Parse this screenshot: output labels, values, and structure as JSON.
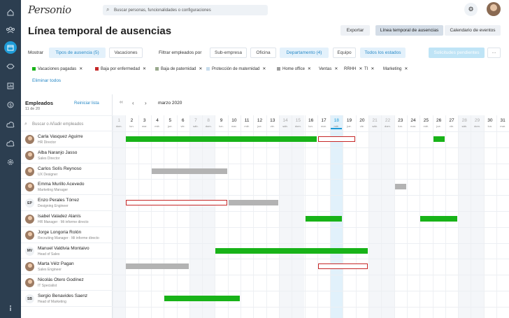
{
  "brand": {
    "logo": "Personio"
  },
  "search": {
    "placeholder": "Buscar personas, funcionalidades o configuraciones"
  },
  "page": {
    "title": "Línea temporal de ausencias"
  },
  "header_actions": {
    "export": "Exportar",
    "timeline": "Línea temporal de ausencias",
    "calendar": "Calendario de eventos"
  },
  "filters": {
    "show_label": "Mostrar",
    "absence_types": "Tipos de ausencia (5)",
    "vacations": "Vacaciones",
    "filter_label": "Filtrar empleados por",
    "subcompany": "Sub-empresa",
    "office": "Oficina",
    "department": "Departamento (4)",
    "team": "Equipo",
    "all_states": "Todos los estados",
    "pending": "Solicitudes pendientes",
    "more": "···",
    "clear": "Eliminar todos"
  },
  "tags": [
    {
      "label": "Vacaciones pagadas",
      "color": "#18b318"
    },
    {
      "label": "Baja por enfermedad",
      "color": "#c62828"
    },
    {
      "label": "Baja de paternidad",
      "color": "#9aaa8e"
    },
    {
      "label": "Protección de maternidad",
      "color": "#c7dcec"
    },
    {
      "label": "Home office",
      "color": "#9e9e9e"
    },
    {
      "label": "Ventas"
    },
    {
      "label": "RRHH"
    },
    {
      "label": "TI"
    },
    {
      "label": "Marketing"
    }
  ],
  "employees_panel": {
    "title": "Empleados",
    "count": "11 de 20",
    "reset": "Reiniciar lista",
    "search_placeholder": "Buscar o Añadir empleados"
  },
  "timeline": {
    "month": "marzo 2020",
    "prev": "‹",
    "next": "›",
    "first": "‹‹",
    "today_index": 17
  },
  "days": [
    {
      "n": "1",
      "d": "dom.",
      "we": true
    },
    {
      "n": "2",
      "d": "lun.",
      "we": false
    },
    {
      "n": "3",
      "d": "mar.",
      "we": false
    },
    {
      "n": "4",
      "d": "mié.",
      "we": false
    },
    {
      "n": "5",
      "d": "jue.",
      "we": false
    },
    {
      "n": "6",
      "d": "vie.",
      "we": false
    },
    {
      "n": "7",
      "d": "sáb.",
      "we": true
    },
    {
      "n": "8",
      "d": "dom.",
      "we": true
    },
    {
      "n": "9",
      "d": "lun.",
      "we": false
    },
    {
      "n": "10",
      "d": "mar.",
      "we": false
    },
    {
      "n": "11",
      "d": "mié.",
      "we": false
    },
    {
      "n": "12",
      "d": "jue.",
      "we": false
    },
    {
      "n": "13",
      "d": "vie.",
      "we": false
    },
    {
      "n": "14",
      "d": "sáb.",
      "we": true
    },
    {
      "n": "15",
      "d": "dom.",
      "we": true
    },
    {
      "n": "16",
      "d": "lun.",
      "we": false
    },
    {
      "n": "17",
      "d": "mar.",
      "we": false
    },
    {
      "n": "18",
      "d": "mié.",
      "we": false
    },
    {
      "n": "19",
      "d": "jue.",
      "we": false
    },
    {
      "n": "20",
      "d": "vie.",
      "we": false
    },
    {
      "n": "21",
      "d": "sáb.",
      "we": true
    },
    {
      "n": "22",
      "d": "dom.",
      "we": true
    },
    {
      "n": "23",
      "d": "lun.",
      "we": false
    },
    {
      "n": "24",
      "d": "mar.",
      "we": false
    },
    {
      "n": "25",
      "d": "mié.",
      "we": false
    },
    {
      "n": "26",
      "d": "jue.",
      "we": false
    },
    {
      "n": "27",
      "d": "vie.",
      "we": false
    },
    {
      "n": "28",
      "d": "sáb.",
      "we": true
    },
    {
      "n": "29",
      "d": "dom.",
      "we": true
    },
    {
      "n": "30",
      "d": "lun.",
      "we": false
    },
    {
      "n": "31",
      "d": "mar.",
      "we": false
    }
  ],
  "employees": [
    {
      "name": "Carla Vasquez Aguirre",
      "role": "HR Director",
      "initials": "",
      "bars": [
        {
          "s": 1,
          "e": 15,
          "t": "green"
        },
        {
          "s": 16,
          "e": 18,
          "t": "outline"
        },
        {
          "s": 25,
          "e": 25,
          "t": "green"
        }
      ]
    },
    {
      "name": "Alba Naranjo Jasso",
      "role": "Sales Director",
      "initials": "",
      "bars": []
    },
    {
      "name": "Carlos Solís Reynoso",
      "role": "UX Designer",
      "initials": "",
      "bars": [
        {
          "s": 3,
          "e": 8,
          "t": "gray"
        }
      ]
    },
    {
      "name": "Emma Murillo Acevedo",
      "role": "Marketing Manager",
      "initials": "",
      "bars": [
        {
          "s": 22,
          "e": 22,
          "t": "gray"
        }
      ]
    },
    {
      "name": "Enzo Perales Tórrez",
      "role": "Designing Engineer",
      "initials": "EP",
      "bars": [
        {
          "s": 1,
          "e": 8,
          "t": "outline"
        },
        {
          "s": 9,
          "e": 12,
          "t": "gray"
        }
      ]
    },
    {
      "name": "Isabel Valadez Alanís",
      "role": "HR Manager · Mi informe directo",
      "initials": "",
      "bars": [
        {
          "s": 15,
          "e": 17,
          "t": "green"
        },
        {
          "s": 24,
          "e": 26,
          "t": "green"
        }
      ]
    },
    {
      "name": "Jorge Longoria Rolón",
      "role": "Recruiting Manager · Mi informe directo",
      "initials": "",
      "bars": []
    },
    {
      "name": "Manuel Valdivia Montaivo",
      "role": "Head of Sales",
      "initials": "MV",
      "bars": [
        {
          "s": 8,
          "e": 19,
          "t": "green"
        }
      ]
    },
    {
      "name": "Marta Vélz Pagan",
      "role": "Sales Engineer",
      "initials": "",
      "bars": [
        {
          "s": 1,
          "e": 5,
          "t": "gray"
        },
        {
          "s": 16,
          "e": 19,
          "t": "outline"
        }
      ]
    },
    {
      "name": "Nicolás Otero Godínez",
      "role": "IT Specialist",
      "initials": "",
      "bars": []
    },
    {
      "name": "Sergio Benavides Saenz",
      "role": "Head of Marketing",
      "initials": "SB",
      "bars": [
        {
          "s": 4,
          "e": 9,
          "t": "green"
        }
      ]
    }
  ]
}
